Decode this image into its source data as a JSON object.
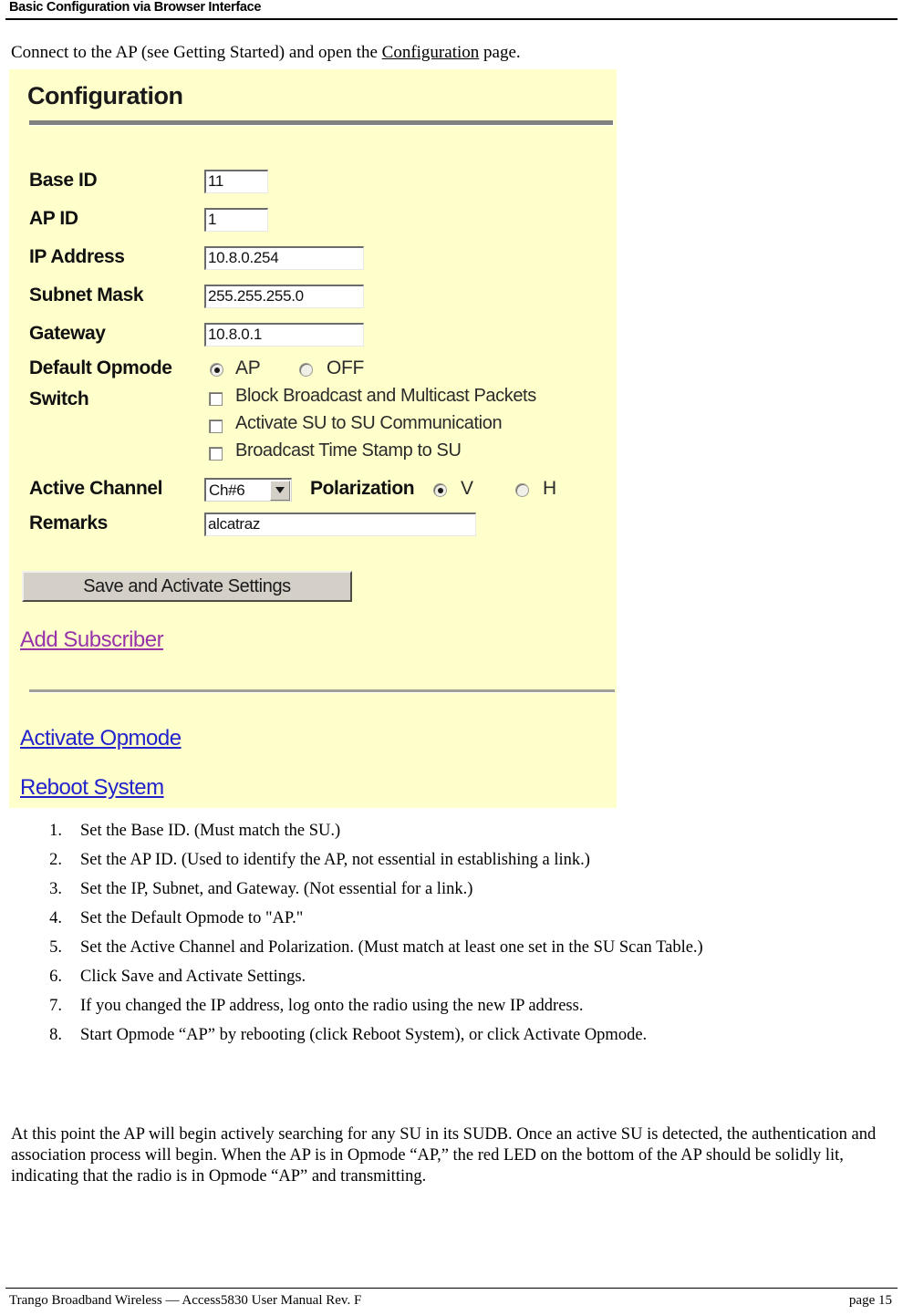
{
  "header": {
    "title": "Basic Configuration via Browser Interface"
  },
  "intro": {
    "before": "Connect to the AP (see Getting Started) and open the ",
    "link": "Configuration",
    "after": " page."
  },
  "config_panel": {
    "title": "Configuration",
    "fields": [
      {
        "label": "Base ID",
        "value": "11"
      },
      {
        "label": "AP ID",
        "value": "1"
      },
      {
        "label": "IP Address",
        "value": "10.8.0.254"
      },
      {
        "label": "Subnet Mask",
        "value": "255.255.255.0"
      },
      {
        "label": "Gateway",
        "value": "10.8.0.1"
      }
    ],
    "default_opmode": {
      "label": "Default Opmode",
      "options": [
        {
          "label": "AP",
          "selected": true
        },
        {
          "label": "OFF",
          "selected": false
        }
      ]
    },
    "switch": {
      "label": "Switch",
      "checkboxes": [
        {
          "label": "Block Broadcast and Multicast Packets",
          "checked": false
        },
        {
          "label": "Activate SU to SU Communication",
          "checked": false
        },
        {
          "label": "Broadcast Time Stamp to SU",
          "checked": false
        }
      ]
    },
    "active_channel": {
      "label": "Active Channel",
      "selected": "Ch#6"
    },
    "polarization": {
      "label": "Polarization",
      "options": [
        {
          "label": "V",
          "selected": true
        },
        {
          "label": "H",
          "selected": false
        }
      ]
    },
    "remarks": {
      "label": "Remarks",
      "value": "alcatraz"
    },
    "save_button": "Save and Activate Settings",
    "links": [
      {
        "label": "Add Subscriber",
        "state": "visited"
      },
      {
        "label": "Activate Opmode",
        "state": "unvisited"
      },
      {
        "label": "Reboot System",
        "state": "unvisited"
      }
    ],
    "colors": {
      "background": "#FFFFCC",
      "visited_link": "#9933AA",
      "unvisited_link": "#2222CC",
      "button_face": "#D4D0C8"
    }
  },
  "steps": [
    {
      "num": "1.",
      "text": "Set the Base ID.  (Must match the SU.)"
    },
    {
      "num": "2.",
      "text": "Set the AP ID.  (Used to identify the AP, not essential in establishing a link.)"
    },
    {
      "num": "3.",
      "text": "Set the IP, Subnet, and Gateway.  (Not essential for a link.)"
    },
    {
      "num": "4.",
      "text": "Set the Default Opmode to \"AP.\""
    },
    {
      "num": "5.",
      "text": "Set the Active Channel and Polarization.  (Must match at least one set in the SU Scan Table.)"
    },
    {
      "num": "6.",
      "text": "Click Save and Activate Settings."
    },
    {
      "num": "7.",
      "text": "If you changed the IP address, log onto the radio using the new IP address."
    },
    {
      "num": "8.",
      "text": "Start Opmode “AP” by rebooting (click Reboot System), or click Activate Opmode."
    }
  ],
  "closing_paragraph": "At this point the AP will begin actively searching for any SU in its SUDB.  Once an active SU is detected, the authentication and association process will begin.  When the AP is in Opmode “AP,” the red LED on the bottom of the AP should be solidly lit, indicating that the radio is in Opmode “AP” and transmitting.",
  "footer": {
    "left": "Trango Broadband Wireless — Access5830 User Manual  Rev. F",
    "right": "page 15"
  }
}
